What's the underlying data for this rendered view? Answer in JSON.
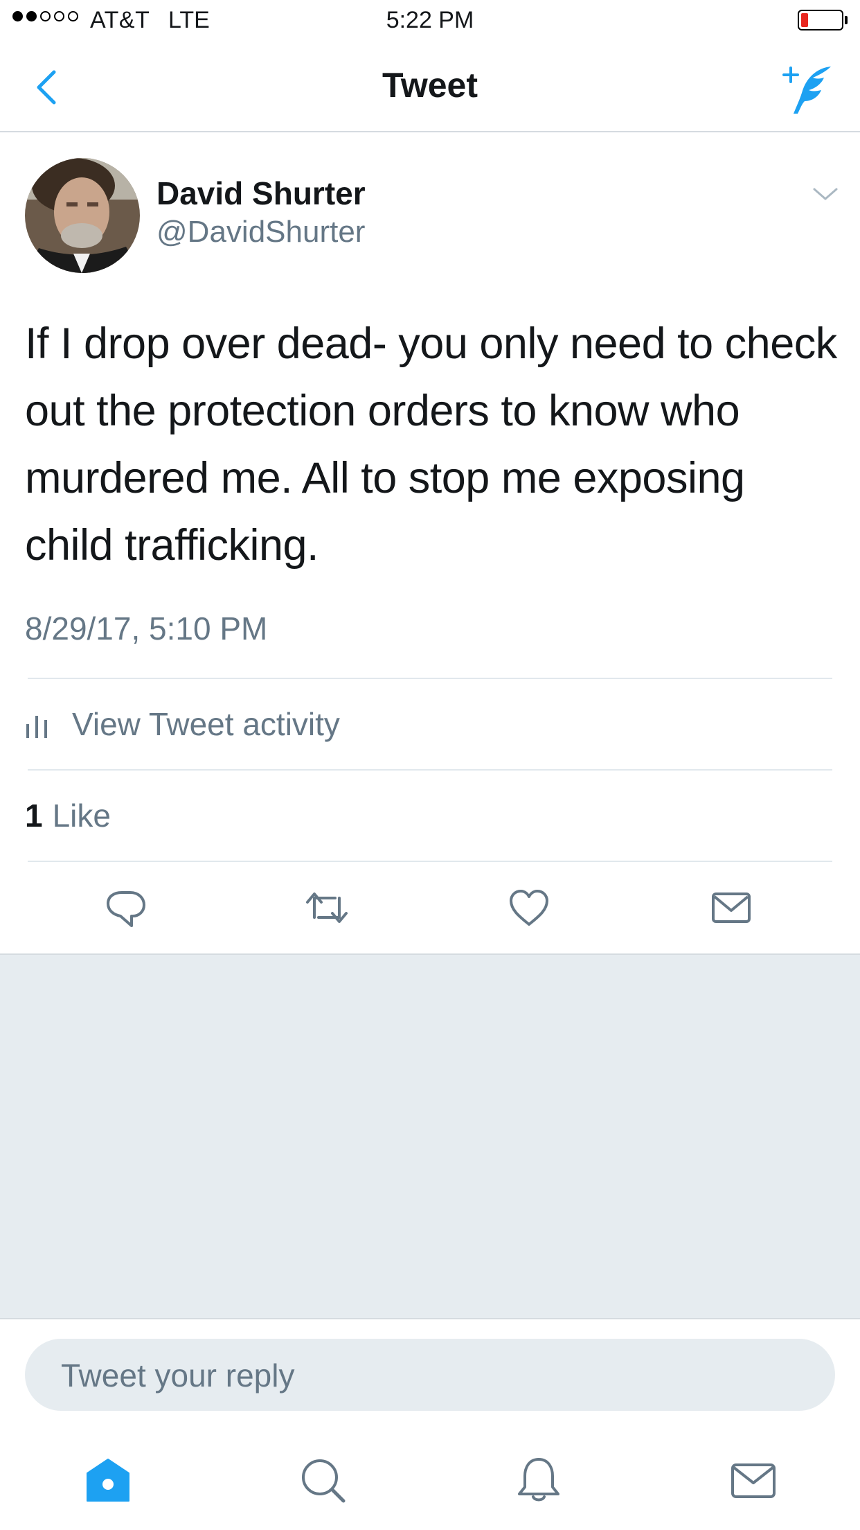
{
  "status_bar": {
    "carrier": "AT&T",
    "network": "LTE",
    "time": "5:22 PM",
    "signal_bars_filled": 2,
    "signal_bars_total": 5,
    "battery_level": 0.12,
    "battery_color": "#e8271f"
  },
  "nav": {
    "title": "Tweet",
    "back_icon": "chevron-left-icon",
    "compose_icon": "compose-tweet-icon",
    "accent_color": "#1da1f2"
  },
  "tweet": {
    "author_name": "David Shurter",
    "author_handle": "@DavidShurter",
    "text": "If I drop over dead- you only need to check out the protection orders to know who murdered me. All to stop me exposing child trafficking.",
    "timestamp": "8/29/17, 5:10 PM",
    "activity_label": "View Tweet activity",
    "like_count": "1",
    "like_label": "Like"
  },
  "actions": [
    "reply-icon",
    "retweet-icon",
    "like-icon",
    "direct-message-icon"
  ],
  "reply": {
    "placeholder": "Tweet your reply"
  },
  "tab_bar": {
    "items": [
      "home-icon",
      "search-icon",
      "notifications-icon",
      "messages-icon"
    ],
    "active": "home-icon"
  }
}
